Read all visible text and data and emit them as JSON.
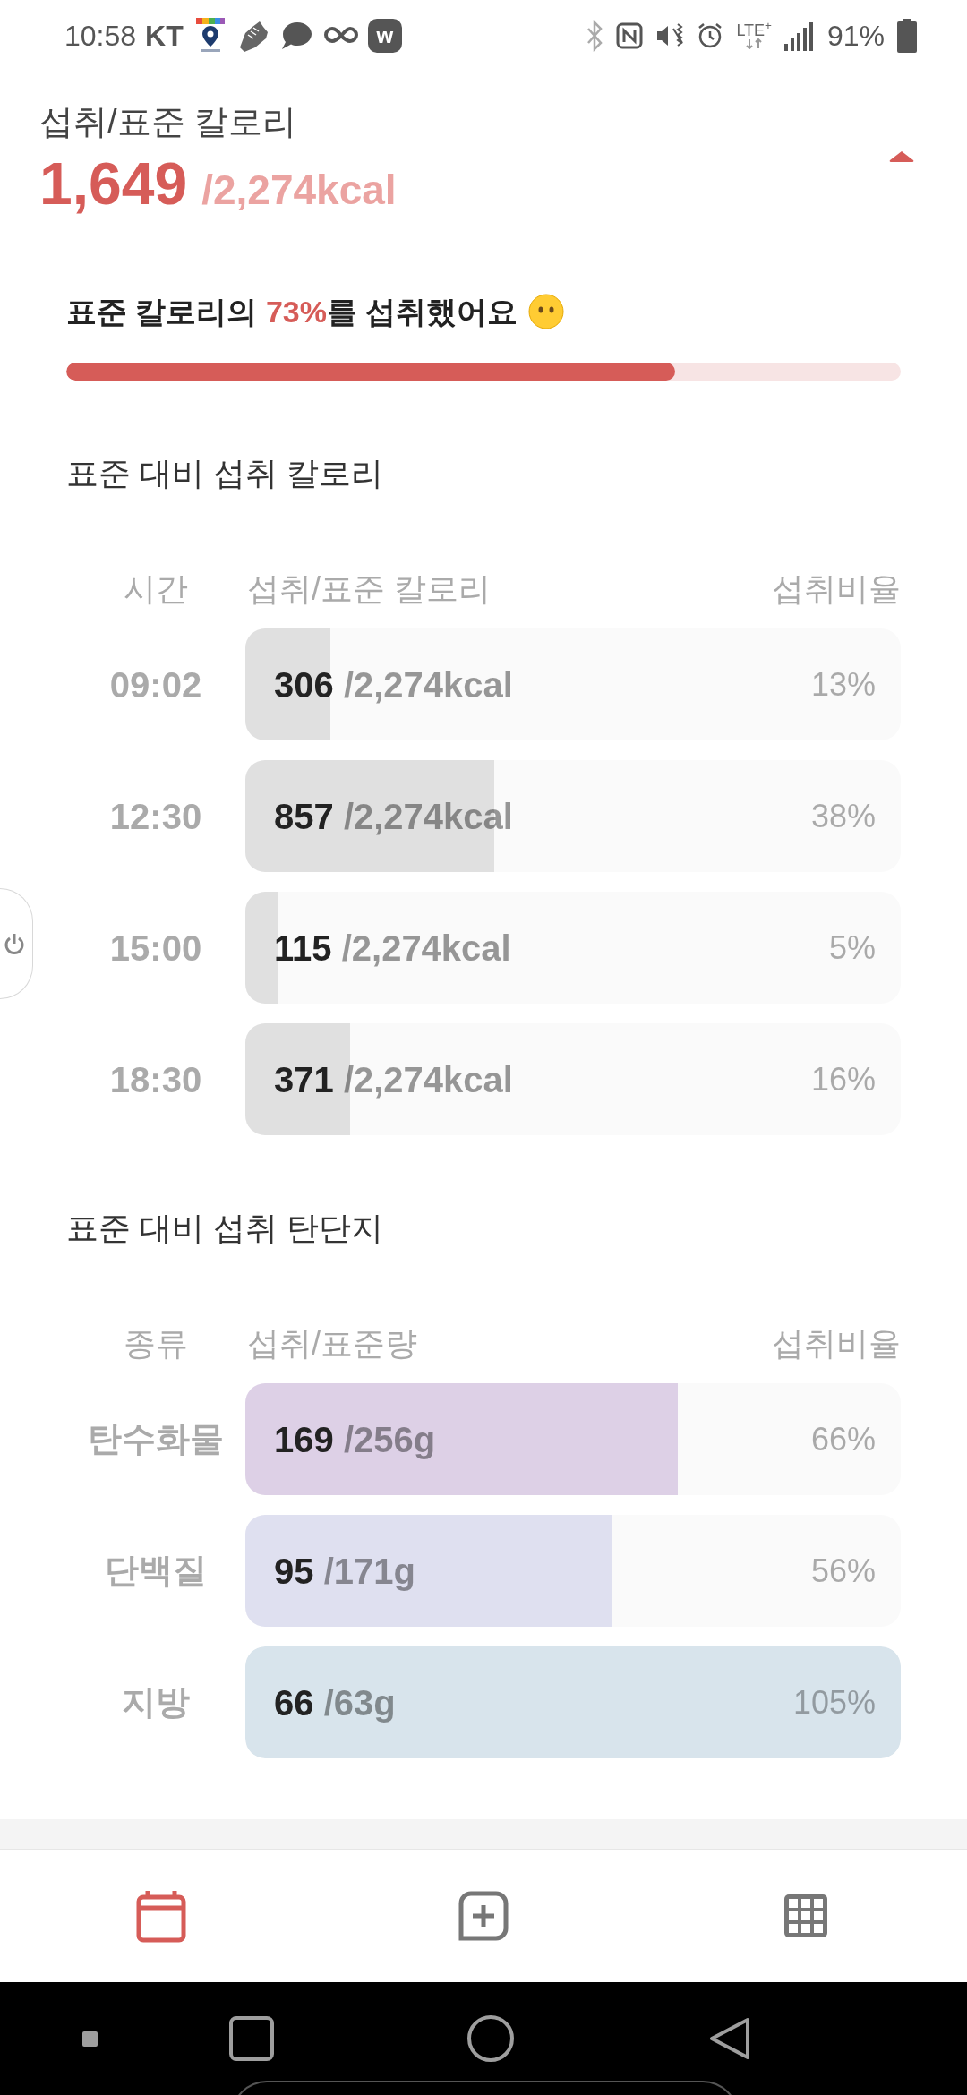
{
  "status_bar": {
    "time": "10:58",
    "carrier": "KT",
    "app_badge": "w",
    "network": "LTE$^{+}$",
    "battery": "91%"
  },
  "summary": {
    "title": "섭취/표준 칼로리",
    "intake": "1,649",
    "standard": "/2,274kcal",
    "expanded": true
  },
  "progress": {
    "prefix": "표준 칼로리의",
    "percent": "73%",
    "suffix": "를 섭취했어요",
    "level": 0.73
  },
  "calorie_section": {
    "title": "표준 대비 섭취 칼로리",
    "columns": [
      "시간",
      "섭취/표준 칼로리",
      "섭취비율"
    ],
    "rows": [
      {
        "label": "09:02",
        "intake": "306",
        "standard": "/2,274kcal",
        "ratio": "13%",
        "level": 0.13
      },
      {
        "label": "12:30",
        "intake": "857",
        "standard": "/2,274kcal",
        "ratio": "38%",
        "level": 0.38
      },
      {
        "label": "15:00",
        "intake": "115",
        "standard": "/2,274kcal",
        "ratio": "5%",
        "level": 0.05
      },
      {
        "label": "18:30",
        "intake": "371",
        "standard": "/2,274kcal",
        "ratio": "16%",
        "level": 0.16
      }
    ]
  },
  "macro_section": {
    "title": "표준 대비 섭취 탄단지",
    "columns": [
      "종류",
      "섭취/표준량",
      "섭취비율"
    ],
    "rows": [
      {
        "label": "탄수화물",
        "intake": "169",
        "standard": "/256g",
        "ratio": "66%",
        "level": 0.66,
        "color": "#ddd0e6"
      },
      {
        "label": "단백질",
        "intake": "95",
        "standard": "/171g",
        "ratio": "56%",
        "level": 0.56,
        "color": "#dfe0f0"
      },
      {
        "label": "지방",
        "intake": "66",
        "standard": "/63g",
        "ratio": "105%",
        "level": 1,
        "color": "#d8e4ec"
      }
    ]
  },
  "bottom_nav": [
    {
      "kind": "calendar",
      "selected": true
    },
    {
      "kind": "add",
      "selected": false
    },
    {
      "kind": "grid",
      "selected": false
    }
  ]
}
